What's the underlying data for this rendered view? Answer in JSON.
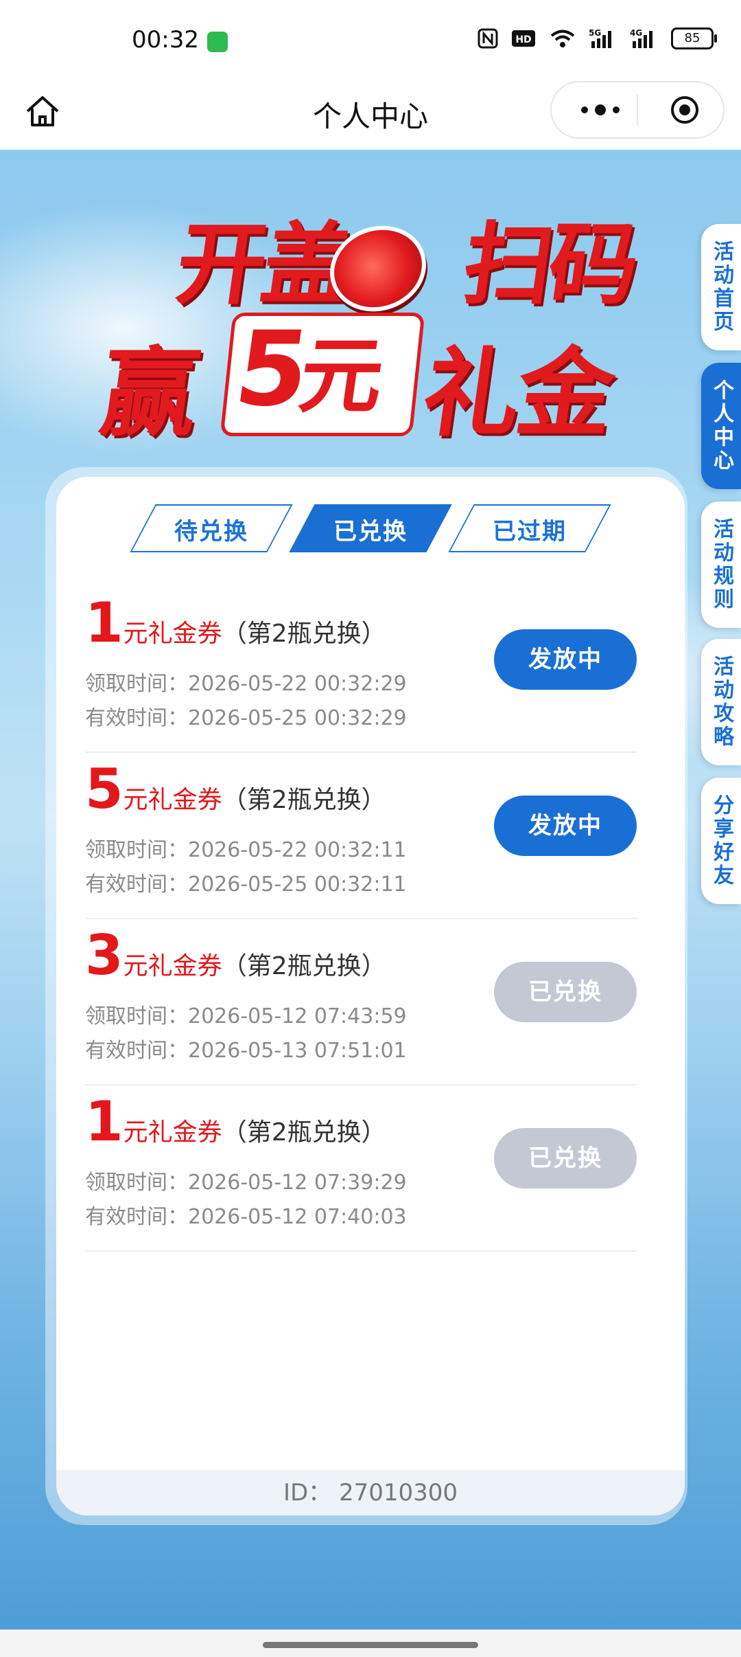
{
  "status_bar": {
    "time": "00:32",
    "icons": [
      "message-app-icon",
      "nfc-icon",
      "hd-icon",
      "wifi-icon",
      "signal-5g-icon",
      "signal-4g-icon"
    ],
    "battery": "85"
  },
  "nav": {
    "title": "个人中心",
    "icons": [
      "home-icon",
      "more-icon",
      "target-icon"
    ]
  },
  "banner": {
    "line1_left": "开盖",
    "line1_right": "扫码",
    "line2_left": "赢",
    "amount": "5",
    "amount_unit": "元",
    "line2_right": "礼金"
  },
  "tabs": [
    {
      "label": "待兑换",
      "active": false
    },
    {
      "label": "已兑换",
      "active": true
    },
    {
      "label": "已过期",
      "active": false
    }
  ],
  "coupons": [
    {
      "amount": "1",
      "unit": "元礼金券",
      "note": "（第2瓶兑换）",
      "claim_time": "领取时间：2026-05-22 00:32:29",
      "valid_time": "有效时间：2026-05-25 00:32:29",
      "status": "发放中",
      "status_type": "active"
    },
    {
      "amount": "5",
      "unit": "元礼金券",
      "note": "（第2瓶兑换）",
      "claim_time": "领取时间：2026-05-22 00:32:11",
      "valid_time": "有效时间：2026-05-25 00:32:11",
      "status": "发放中",
      "status_type": "active"
    },
    {
      "amount": "3",
      "unit": "元礼金券",
      "note": "（第2瓶兑换）",
      "claim_time": "领取时间：2026-05-12 07:43:59",
      "valid_time": "有效时间：2026-05-13 07:51:01",
      "status": "已兑换",
      "status_type": "done"
    },
    {
      "amount": "1",
      "unit": "元礼金券",
      "note": "（第2瓶兑换）",
      "claim_time": "领取时间：2026-05-12 07:39:29",
      "valid_time": "有效时间：2026-05-12 07:40:03",
      "status": "已兑换",
      "status_type": "done"
    }
  ],
  "footer_id": "ID：  27010300",
  "side_tabs": [
    {
      "label": "活动首页",
      "active": false
    },
    {
      "label": "个人中心",
      "active": true
    },
    {
      "label": "活动规则",
      "active": false
    },
    {
      "label": "活动攻略",
      "active": false
    },
    {
      "label": "分享好友",
      "active": false
    }
  ],
  "colors": {
    "accent_blue": "#1a6fd4",
    "coupon_red": "#e3171c",
    "done_gray": "#c3c8d3"
  }
}
